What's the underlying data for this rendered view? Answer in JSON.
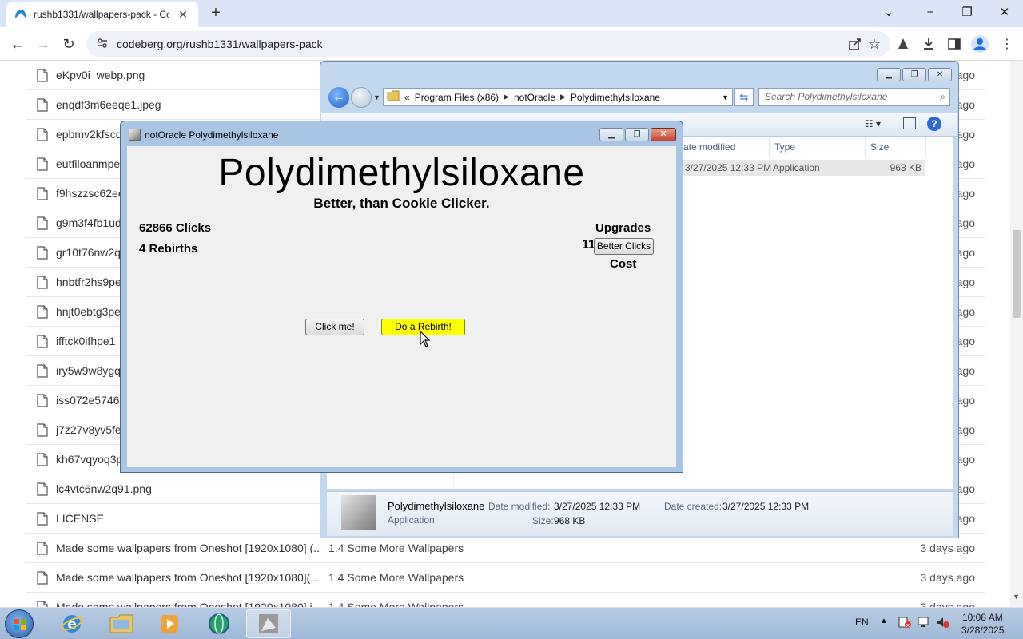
{
  "browser": {
    "tab_title": "rushb1331/wallpapers-pack - Co",
    "new_tab": "+",
    "url": "codeberg.org/rushb1331/wallpapers-pack",
    "window_controls": {
      "minimize": "−",
      "maximize": "❐",
      "close": "✕"
    },
    "tab_list": "⌄"
  },
  "files": [
    {
      "name": "eKpv0i_webp.png",
      "msg": "",
      "date": "ago"
    },
    {
      "name": "enqdf3m6eeqe1.jpeg",
      "msg": "",
      "date": "ago"
    },
    {
      "name": "epbmv2kfscd",
      "msg": "",
      "date": "ago"
    },
    {
      "name": "eutfiloanmpe",
      "msg": "",
      "date": "ago"
    },
    {
      "name": "f9hszzsc62ee",
      "msg": "",
      "date": "ago"
    },
    {
      "name": "g9m3f4fb1ud",
      "msg": "",
      "date": "ago"
    },
    {
      "name": "gr10t76nw2q",
      "msg": "",
      "date": "ago"
    },
    {
      "name": "hnbtfr2hs9pe",
      "msg": "",
      "date": "ago"
    },
    {
      "name": "hnjt0ebtg3pe",
      "msg": "",
      "date": "ago"
    },
    {
      "name": "ifftck0ifhpe1.",
      "msg": "",
      "date": "ago"
    },
    {
      "name": "iry5w9w8ygq",
      "msg": "",
      "date": "ago"
    },
    {
      "name": "iss072e57463",
      "msg": "",
      "date": "ago"
    },
    {
      "name": "j7z27v8yv5fe",
      "msg": "",
      "date": "ago"
    },
    {
      "name": "kh67vqyoq3p",
      "msg": "",
      "date": "ago"
    },
    {
      "name": "lc4vtc6nw2q91.png",
      "msg": "",
      "date": "ago"
    },
    {
      "name": "LICENSE",
      "msg": "",
      "date": "ago"
    },
    {
      "name": "Made some wallpapers from Oneshot [1920x1080] (...",
      "msg": "1.4 Some More Wallpapers",
      "date": "3 days ago"
    },
    {
      "name": "Made some wallpapers from Oneshot [1920x1080](...",
      "msg": "1.4 Some More Wallpapers",
      "date": "3 days ago"
    },
    {
      "name": "Made some wallpapers from Oneshot [1920x1080] i",
      "msg": "1.4 Some More Wallpapers",
      "date": "3 days ago"
    }
  ],
  "explorer": {
    "path": [
      "«",
      "Program Files (x86)",
      "notOracle",
      "Polydimethylsiloxane"
    ],
    "search_placeholder": "Search Polydimethylsiloxane",
    "columns": [
      "ate modified",
      "Type",
      "Size"
    ],
    "row": {
      "date": "3/27/2025 12:33 PM",
      "type": "Application",
      "size": "968 KB"
    },
    "details": {
      "name": "Polydimethylsiloxane",
      "kind": "Application",
      "modified_label": "Date modified:",
      "modified": "3/27/2025 12:33 PM",
      "created_label": "Date created:",
      "created": "3/27/2025 12:33 PM",
      "size_label": "Size:",
      "size": "968 KB"
    }
  },
  "app": {
    "window_title": "notOracle Polydimethylsiloxane",
    "title": "Polydimethylsiloxane",
    "subtitle": "Better, than Cookie Clicker.",
    "clicks": "62866 Clicks",
    "rebirths": "4 Rebirths",
    "upgrades_label": "Upgrades",
    "upgrade_level": "11",
    "better_clicks": "Better Clicks",
    "cost_label": "Cost",
    "click_me": "Click me!",
    "do_rebirth": "Do a Rebirth!"
  },
  "taskbar": {
    "lang": "EN",
    "time": "10:08 AM",
    "date": "3/28/2025"
  }
}
